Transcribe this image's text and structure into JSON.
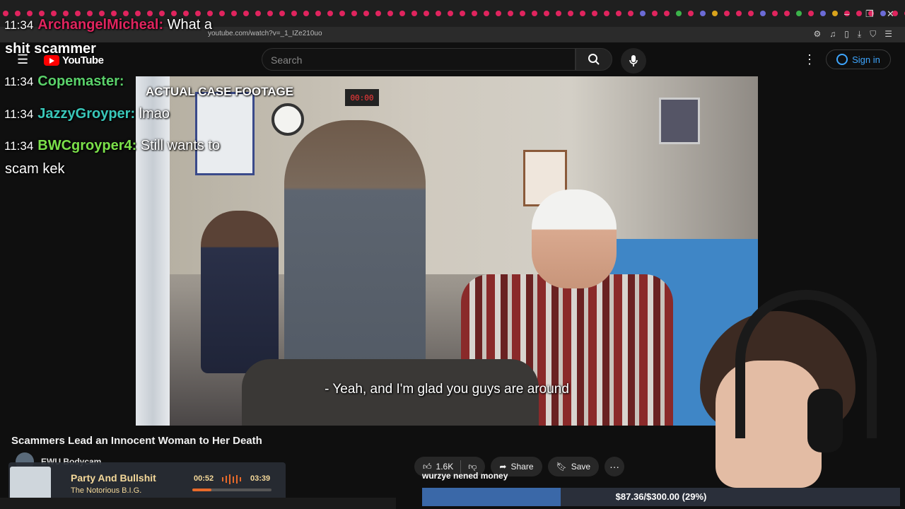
{
  "browser": {
    "url": "youtube.com/watch?v=_1_IZe210uo"
  },
  "youtube": {
    "logo_text": "YouTube",
    "search_placeholder": "Search",
    "signin_label": "Sign in"
  },
  "video": {
    "subtitle": "- Yeah, and I'm glad you guys are around",
    "title": "Scammers Lead an Innocent Woman to Her Death",
    "channel": "EWU Bodycam",
    "likes": "1.6K",
    "share_label": "Share",
    "save_label": "Save"
  },
  "overlay": {
    "case_label": "ACTUAL CASE FOOTAGE",
    "chat": [
      {
        "time": "11:34",
        "user": "ArchangelMicheal:",
        "color": "#e0245e",
        "message": "What a",
        "wrap": "shit scammer"
      },
      {
        "time": "11:34",
        "user": "Copemaster:",
        "color": "#5ad16a",
        "message": ""
      },
      {
        "time": "11:34",
        "user": "JazzyGroyper:",
        "color": "#39c7b9",
        "message": "lmao"
      },
      {
        "time": "11:34",
        "user": "BWCgroyper4:",
        "color": "#7be04a",
        "message": "Still wants to",
        "wrap": "scam kek"
      }
    ]
  },
  "music": {
    "title": "Party And Bullshit",
    "artist": "The Notorious B.I.G.",
    "elapsed": "00:52",
    "duration": "03:39",
    "progress": 0.24
  },
  "donation": {
    "message": "wurzye nened money",
    "goal_text": "$87.36/$300.00 (29%)",
    "progress": 0.29
  },
  "colors": {
    "youtube_red": "#ff0000",
    "link_blue": "#3ea6ff",
    "goal_fill": "#3a68a8"
  }
}
